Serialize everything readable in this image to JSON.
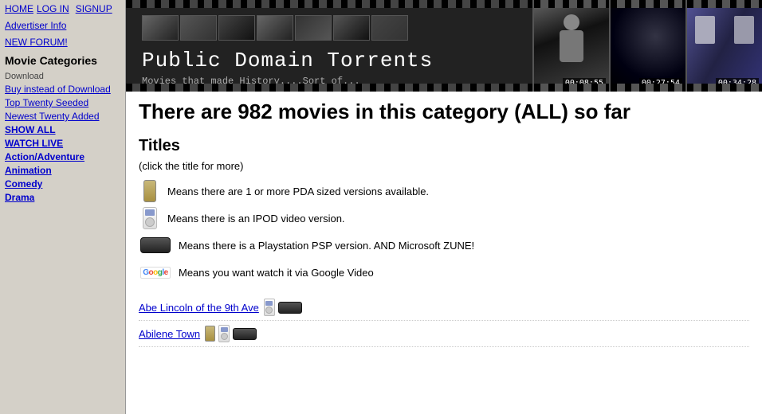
{
  "sidebar": {
    "top_links": [
      "HOME",
      "LOG IN",
      "SIGNUP"
    ],
    "advertiser_link": "Advertiser Info",
    "forum_link": "NEW FORUM!",
    "categories_title": "Movie Categories",
    "download_label": "Download",
    "nav_links": [
      {
        "label": "Buy instead of Download",
        "bold": false
      },
      {
        "label": "Top Twenty Seeded",
        "bold": false
      },
      {
        "label": "Newest Twenty Added",
        "bold": false
      },
      {
        "label": "SHOW ALL",
        "bold": true
      },
      {
        "label": "WATCH LIVE",
        "bold": true
      },
      {
        "label": "Action/Adventure",
        "bold": true
      },
      {
        "label": "Animation",
        "bold": true
      },
      {
        "label": "Comedy",
        "bold": true
      },
      {
        "label": "Drama",
        "bold": true
      }
    ]
  },
  "banner": {
    "title": "Public Domain Torrents",
    "subtitle": "Movies that made History....Sort of...",
    "thumbnails": [
      {
        "time": "00:08:55"
      },
      {
        "time": "00:27:54"
      },
      {
        "time": "00:34:28"
      }
    ]
  },
  "content": {
    "heading": "There are 982 movies in this category (ALL) so far",
    "titles_section_label": "Titles",
    "click_note": "(click the title for more)",
    "legend": [
      {
        "icon": "pda",
        "text": "Means there are 1 or more PDA sized versions available."
      },
      {
        "icon": "ipod",
        "text": "Means there is an IPOD video version."
      },
      {
        "icon": "psp",
        "text": "Means there is a Playstation PSP version. AND Microsoft ZUNE!"
      },
      {
        "icon": "google",
        "text": "Means you want watch it via Google Video"
      }
    ],
    "movies": [
      {
        "title": "Abe Lincoln of the 9th Ave",
        "icons": [
          "ipod",
          "psp"
        ]
      },
      {
        "title": "Abilene Town",
        "icons": [
          "pda",
          "ipod",
          "psp"
        ]
      }
    ]
  }
}
